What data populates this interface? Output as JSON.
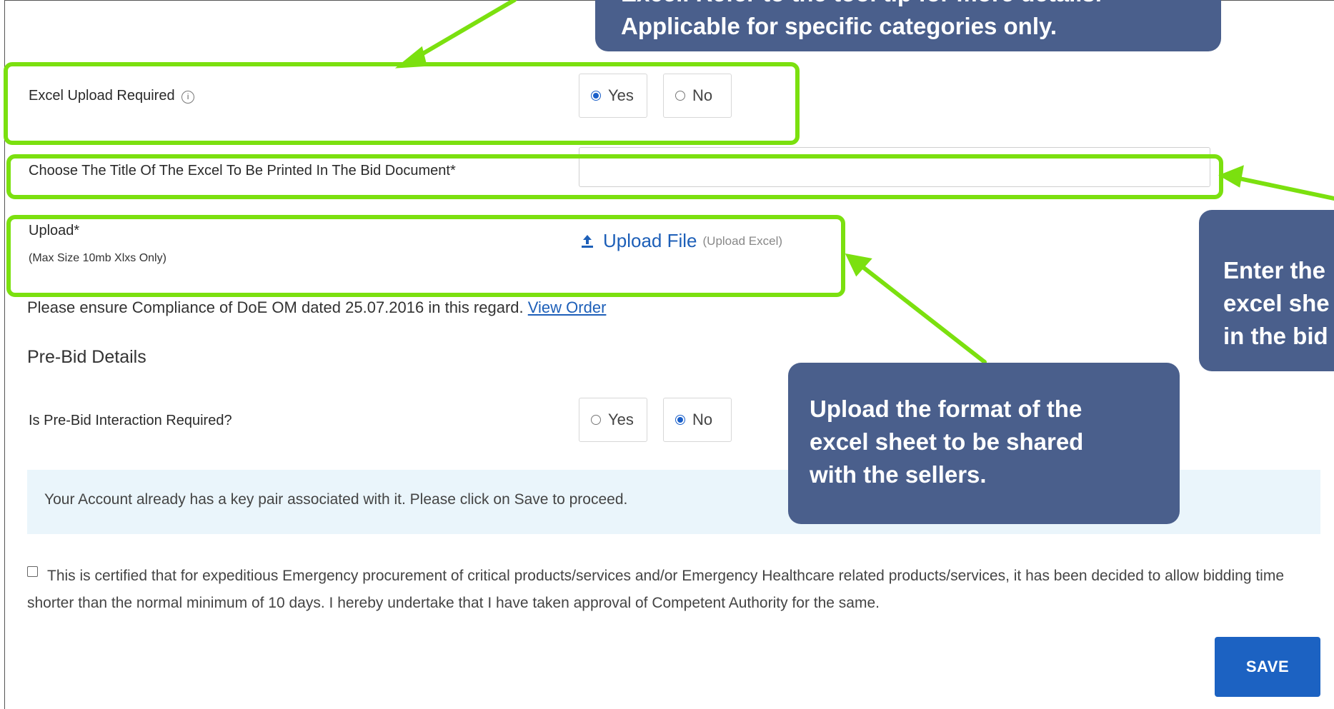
{
  "colors": {
    "callout_bg": "#4a5f8c",
    "highlight_green": "#7be00f",
    "link_blue": "#1d5fb8",
    "save_button": "#1c62c2",
    "notice_bg": "#eaf5fb"
  },
  "callouts": {
    "top": {
      "line1": "Excel. Refer to the tool tip for more details.",
      "line2": "Applicable for specific categories only."
    },
    "right": {
      "line1": "Enter the",
      "line2": "excel she",
      "line3": "in the bid"
    },
    "middle": {
      "line1": "Upload the format of the",
      "line2": "excel sheet to be shared",
      "line3": "with the sellers."
    }
  },
  "excel_upload": {
    "label": "Excel Upload Required",
    "info_icon": "info-icon",
    "options": [
      {
        "label": "Yes",
        "checked": true
      },
      {
        "label": "No",
        "checked": false
      }
    ]
  },
  "excel_title": {
    "label": "Choose The Title Of The Excel To Be Printed In The Bid Document*",
    "value": ""
  },
  "upload": {
    "label": "Upload*",
    "sublabel": "(Max Size 10mb Xlxs Only)",
    "link_text": "Upload File",
    "link_hint": "(Upload Excel)",
    "icon": "upload-icon"
  },
  "compliance": {
    "text": "Please ensure Compliance of DoE OM dated 25.07.2016 in this regard.",
    "link": "View Order"
  },
  "pre_bid": {
    "heading": "Pre-Bid Details",
    "question": "Is Pre-Bid Interaction Required?",
    "options": [
      {
        "label": "Yes",
        "checked": false
      },
      {
        "label": "No",
        "checked": true
      }
    ]
  },
  "notice": {
    "text": "Your Account already has a key pair associated with it. Please click on Save to proceed."
  },
  "certification": {
    "text": "This is certified that for expeditious Emergency procurement of critical products/services and/or Emergency Healthcare related products/services, it has been decided to allow bidding time shorter than the normal minimum of 10 days. I hereby undertake that I have taken approval of Competent Authority for the same.",
    "checked": false
  },
  "save_button": {
    "label": "SAVE"
  }
}
